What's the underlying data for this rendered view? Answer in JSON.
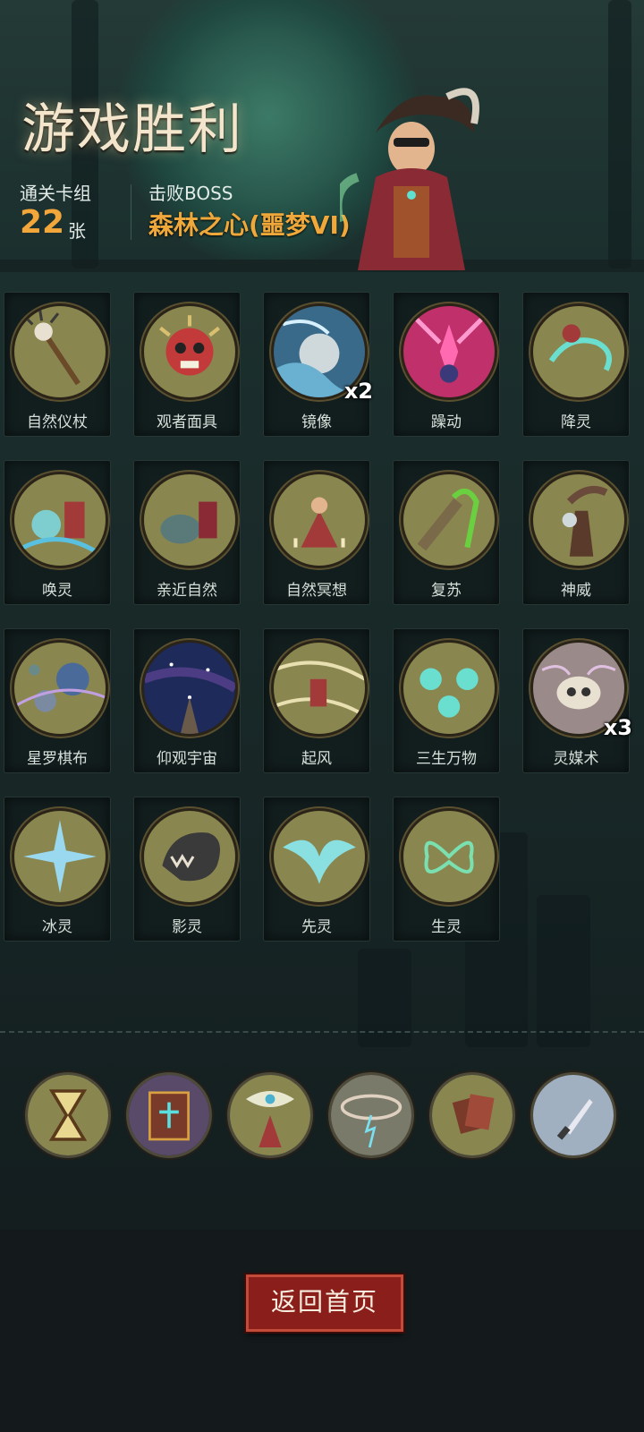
{
  "header": {
    "title": "游戏胜利",
    "deck_label": "通关卡组",
    "deck_count": "22",
    "deck_unit": "张",
    "boss_label": "击败BOSS",
    "boss_name": "森林之心(噩梦VI)"
  },
  "cards": [
    {
      "name": "自然仪杖",
      "icon": "staff-icon",
      "count": ""
    },
    {
      "name": "观者面具",
      "icon": "mask-icon",
      "count": ""
    },
    {
      "name": "镜像",
      "icon": "mirror-orb-icon",
      "count": "x2"
    },
    {
      "name": "躁动",
      "icon": "frenzy-icon",
      "count": ""
    },
    {
      "name": "降灵",
      "icon": "spirit-summon-icon",
      "count": ""
    },
    {
      "name": "唤灵",
      "icon": "spirit-call-icon",
      "count": ""
    },
    {
      "name": "亲近自然",
      "icon": "nature-bond-icon",
      "count": ""
    },
    {
      "name": "自然冥想",
      "icon": "meditation-icon",
      "count": ""
    },
    {
      "name": "复苏",
      "icon": "revival-icon",
      "count": ""
    },
    {
      "name": "神威",
      "icon": "divine-might-icon",
      "count": ""
    },
    {
      "name": "星罗棋布",
      "icon": "planets-icon",
      "count": ""
    },
    {
      "name": "仰观宇宙",
      "icon": "cosmos-icon",
      "count": ""
    },
    {
      "name": "起风",
      "icon": "wind-icon",
      "count": ""
    },
    {
      "name": "三生万物",
      "icon": "spirits-icon",
      "count": ""
    },
    {
      "name": "灵媒术",
      "icon": "skull-icon",
      "count": "x3"
    },
    {
      "name": "冰灵",
      "icon": "ice-spirit-icon",
      "count": ""
    },
    {
      "name": "影灵",
      "icon": "shadow-spirit-icon",
      "count": ""
    },
    {
      "name": "先灵",
      "icon": "eagle-spirit-icon",
      "count": ""
    },
    {
      "name": "生灵",
      "icon": "butterfly-spirit-icon",
      "count": ""
    }
  ],
  "relics": [
    {
      "icon": "hourglass-icon"
    },
    {
      "icon": "spellbook-icon"
    },
    {
      "icon": "seer-eye-icon"
    },
    {
      "icon": "storm-icon"
    },
    {
      "icon": "scroll-cards-icon"
    },
    {
      "icon": "dagger-icon"
    }
  ],
  "footer": {
    "return_label": "返回首页"
  },
  "colors": {
    "accent_orange": "#f0a83a",
    "button_red": "#8a1e1a",
    "disc_olive": "#8a8650"
  }
}
